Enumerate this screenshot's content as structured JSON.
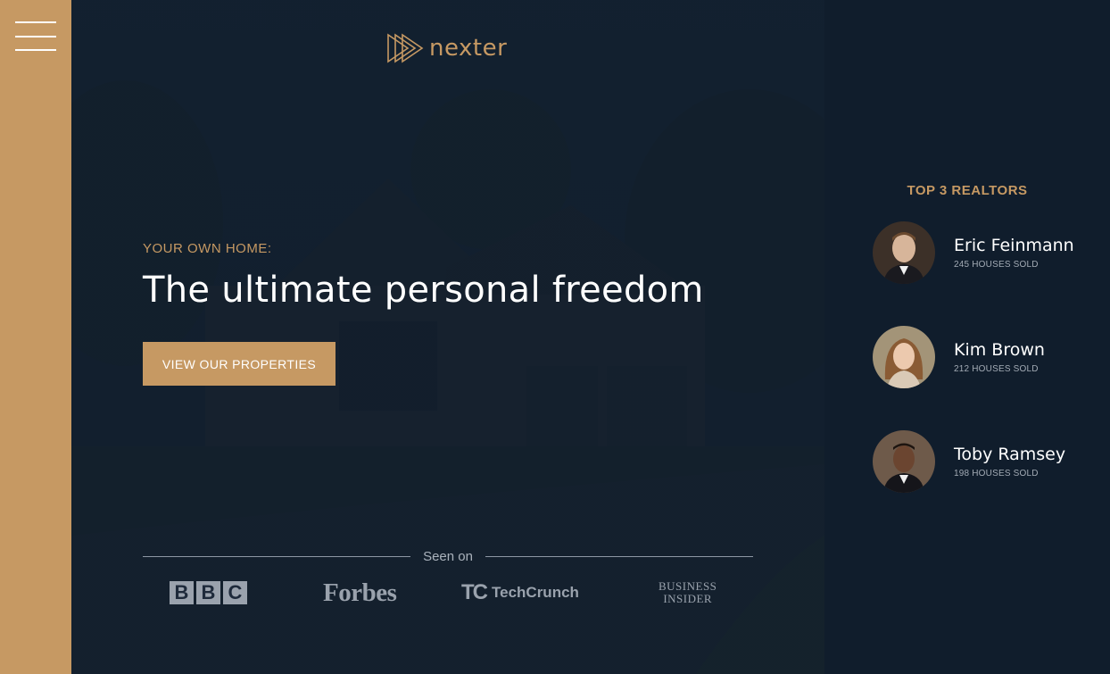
{
  "sidebar": {
    "menu_icon": "hamburger-menu-icon"
  },
  "header": {
    "logo_icon": "nexter-triangles-logo-icon",
    "logo_text": "nexter",
    "pre_title": "YOUR OWN HOME:",
    "title": "The ultimate personal freedom",
    "cta_label": "VIEW OUR PROPERTIES",
    "seen_on_label": "Seen on",
    "brands": [
      {
        "name": "BBC",
        "letters": [
          "B",
          "B",
          "C"
        ]
      },
      {
        "name": "Forbes",
        "text": "Forbes"
      },
      {
        "name": "TechCrunch",
        "mark": "TC",
        "text": "TechCrunch"
      },
      {
        "name": "Business Insider",
        "line1": "BUSINESS",
        "line2": "INSIDER"
      }
    ]
  },
  "realtors": {
    "title": "TOP 3 REALTORS",
    "items": [
      {
        "name": "Eric Feinmann",
        "sold": "245 HOUSES SOLD"
      },
      {
        "name": "Kim Brown",
        "sold": "212 HOUSES SOLD"
      },
      {
        "name": "Toby Ramsey",
        "sold": "198 HOUSES SOLD"
      }
    ]
  },
  "colors": {
    "primary": "#c69963",
    "dark": "#101d2c",
    "white": "#ffffff"
  }
}
